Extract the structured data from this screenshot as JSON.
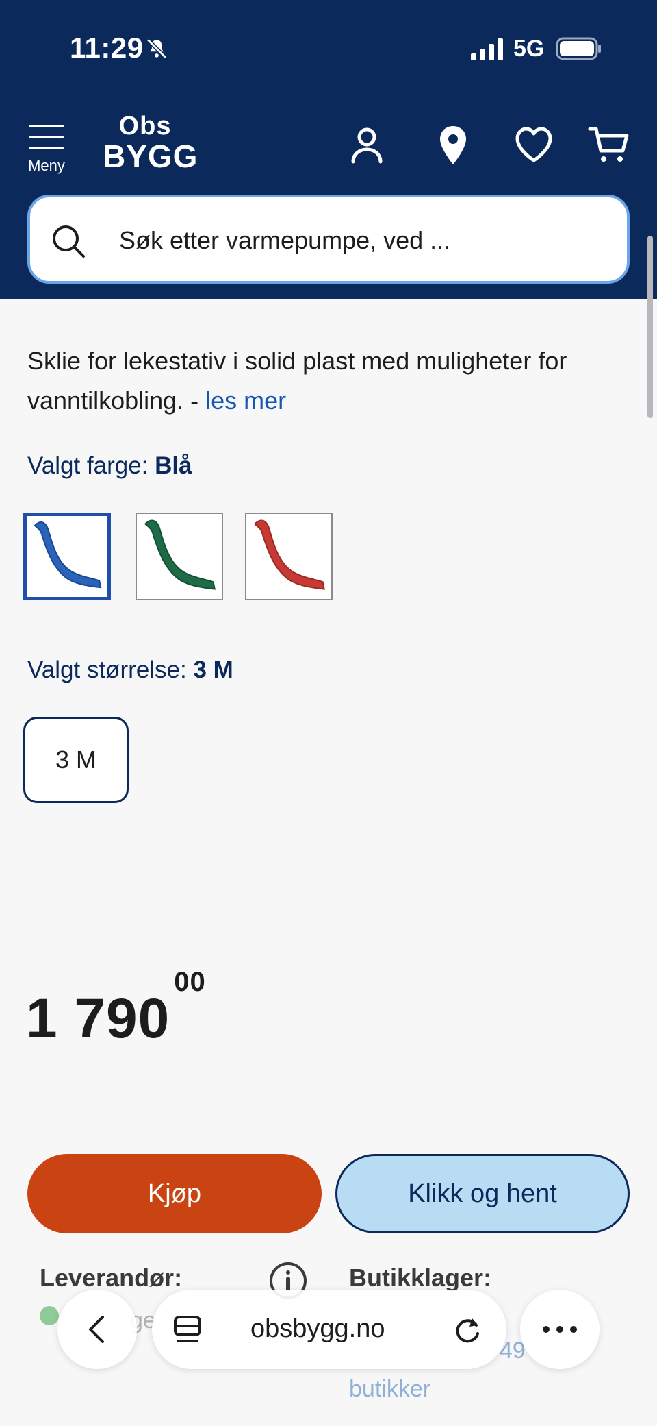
{
  "status_bar": {
    "time": "11:29",
    "network": "5G"
  },
  "header": {
    "menu_label": "Meny",
    "logo_line1": "Obs",
    "logo_line2": "BYGG",
    "search_placeholder": "Søk etter varmepumpe, ved ..."
  },
  "product": {
    "description": "Sklie for lekestativ i solid plast med muligheter for vanntilkobling. - ",
    "read_more": "les mer",
    "color_label": "Valgt farge: ",
    "color_value": "Blå",
    "colors": [
      {
        "name": "Blå",
        "hex": "#2a63b8",
        "selected": true
      },
      {
        "name": "Grønn",
        "hex": "#1f6b45",
        "selected": false
      },
      {
        "name": "Rød",
        "hex": "#c73a33",
        "selected": false
      }
    ],
    "size_label": "Valgt størrelse: ",
    "size_value": "3 M",
    "sizes": [
      "3 M"
    ],
    "price_main": "1 790",
    "price_cents": "00"
  },
  "actions": {
    "buy": "Kjøp",
    "click_collect": "Klikk og hent"
  },
  "stock": {
    "supplier_label": "Leverandør:",
    "store_label": "Butikklager:",
    "supplier_status_partial": "ge",
    "stores_count_partial": "49",
    "stores_word": "butikker"
  },
  "browser": {
    "url": "obsbygg.no"
  },
  "colors": {
    "header_bg": "#0b2a5b",
    "buy_bg": "#c94412",
    "collect_bg": "#b9dcf5",
    "link": "#1856b4"
  }
}
